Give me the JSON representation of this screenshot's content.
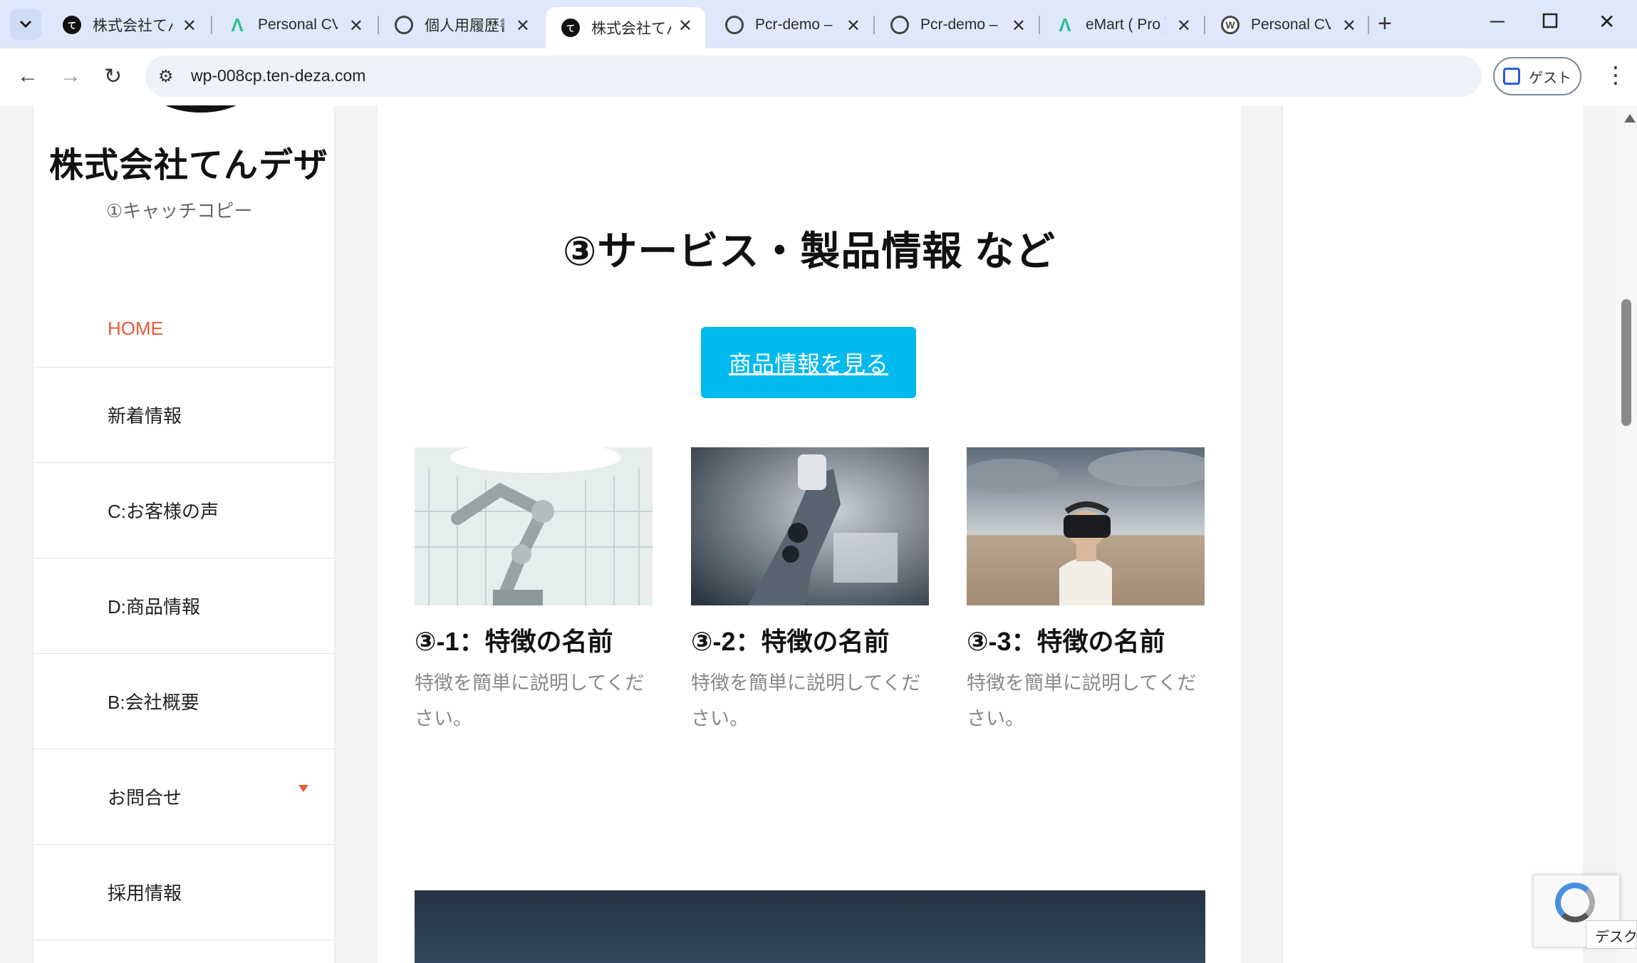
{
  "browser": {
    "tabs": [
      {
        "label": "株式会社てん",
        "favicon": "tenndeza-logo-icon",
        "active": false
      },
      {
        "label": "Personal CV",
        "favicon": "astra-icon",
        "active": false
      },
      {
        "label": "個人用履歴書",
        "favicon": "globe-icon",
        "active": false
      },
      {
        "label": "株式会社てん",
        "favicon": "tenndeza-logo-icon",
        "active": true
      },
      {
        "label": "Pcr-demo –",
        "favicon": "globe-icon",
        "active": false
      },
      {
        "label": "Pcr-demo –",
        "favicon": "globe-icon",
        "active": false
      },
      {
        "label": "eMart ( Pro )",
        "favicon": "astra-icon",
        "active": false
      },
      {
        "label": "Personal CV",
        "favicon": "wordpress-icon",
        "active": false
      }
    ],
    "url": "wp-008cp.ten-deza.com",
    "guest_label": "ゲスト",
    "tooltip": "デスクト"
  },
  "sidebar": {
    "site_title": "株式会社てんデザ",
    "tagline": "①キャッチコピー",
    "menu": [
      {
        "label": "HOME",
        "current": true
      },
      {
        "label": "新着情報"
      },
      {
        "label": "C:お客様の声"
      },
      {
        "label": "D:商品情報"
      },
      {
        "label": "B:会社概要"
      },
      {
        "label": "お問合せ",
        "has_submenu": true
      },
      {
        "label": "採用情報"
      }
    ]
  },
  "main": {
    "section_title": "③サービス・製品情報 など",
    "cta_label": "商品情報を見る",
    "cards": [
      {
        "title": "③-1：特徴の名前",
        "desc": "特徴を簡単に説明してください。",
        "image": "robot-arm-lab-photo"
      },
      {
        "title": "③-2：特徴の名前",
        "desc": "特徴を簡単に説明してください。",
        "image": "robot-closeup-photo"
      },
      {
        "title": "③-3：特徴の名前",
        "desc": "特徴を簡単に説明してください。",
        "image": "vr-headset-desert-photo"
      }
    ]
  },
  "colors": {
    "accent_cta": "#00b9ef",
    "menu_current": "#e85a3a",
    "tabbar_bg": "#dfe8fa"
  }
}
